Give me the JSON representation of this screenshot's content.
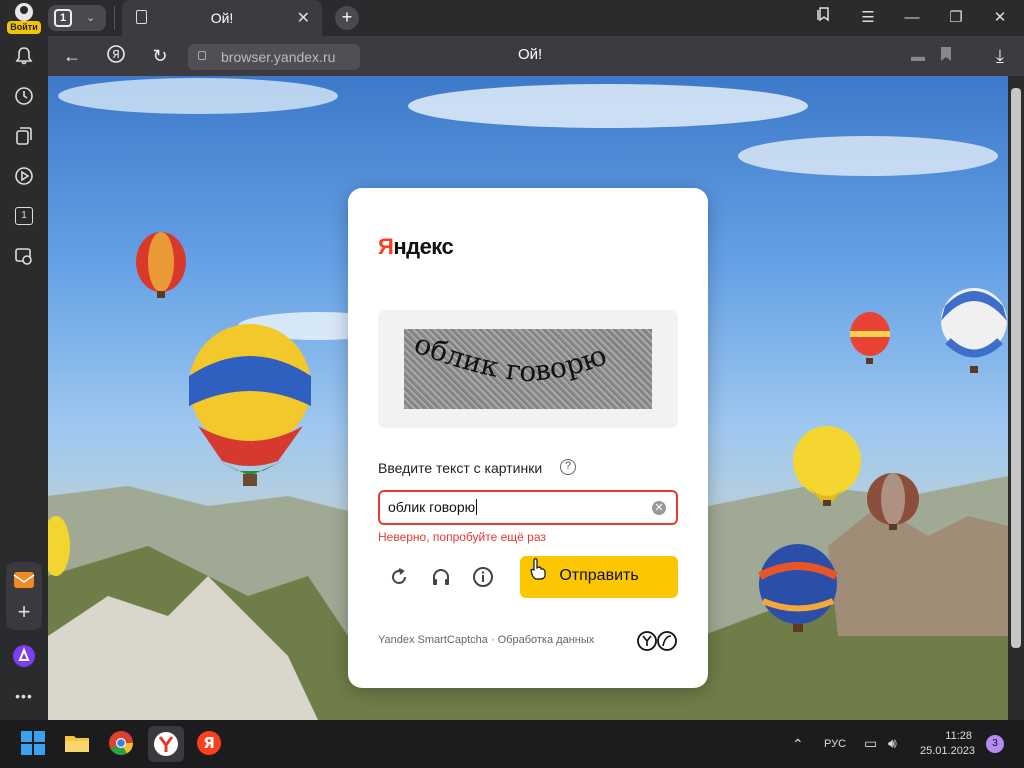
{
  "sidebar": {
    "login_label": "Войти",
    "items": [
      {
        "icon": "bell-icon"
      },
      {
        "icon": "history-icon"
      },
      {
        "icon": "collections-icon"
      },
      {
        "icon": "video-icon"
      },
      {
        "icon": "tab-one-icon",
        "label": "1"
      },
      {
        "icon": "screenshot-icon"
      }
    ],
    "bottom": [
      {
        "icon": "mail-icon"
      },
      {
        "icon": "add-icon"
      },
      {
        "icon": "alice-icon"
      },
      {
        "icon": "more-icon"
      }
    ]
  },
  "tabs": {
    "count": "1",
    "active": {
      "title": "Ой!"
    }
  },
  "toolbar": {
    "url": "browser.yandex.ru",
    "page_title": "Ой!"
  },
  "captcha": {
    "brand": "Яндекс",
    "brand_first": "Я",
    "brand_rest": "ндекс",
    "captcha_text": "облик говорю",
    "instruction": "Введите текст с картинки",
    "input_value": "облик говорю",
    "error": "Неверно, попробуйте ещё раз",
    "submit_label": "Отправить",
    "footer": "Yandex SmartCaptcha · Обработка данных"
  },
  "taskbar": {
    "lang": "РУС",
    "time": "11:28",
    "date": "25.01.2023",
    "notifications": "3"
  },
  "colors": {
    "accent": "#fcc600",
    "error": "#e53935",
    "brand_red": "#fc3f1d"
  }
}
